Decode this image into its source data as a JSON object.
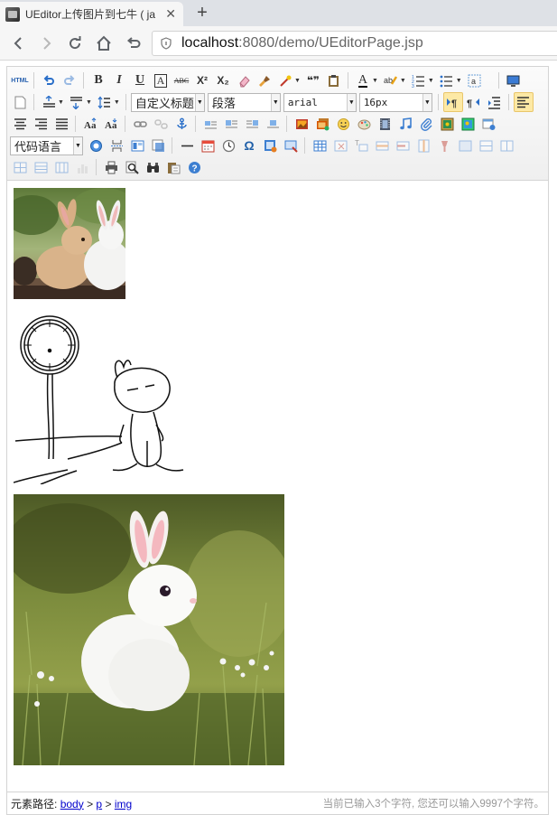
{
  "browser": {
    "tab_title": "UEditor上传图片到七牛 ( ja",
    "tab_close": "✕",
    "new_tab": "+",
    "address_host": "localhost",
    "address_rest": ":8080/demo/UEditorPage.jsp"
  },
  "toolbar": {
    "html_label": "HTML",
    "custom_title": "自定义标题",
    "paragraph": "段落",
    "font_family": "arial",
    "font_size": "16px",
    "code_language": "代码语言",
    "bold": "B",
    "italic": "I",
    "underline": "U",
    "fontborder": "A",
    "strike": "ABC",
    "superscript": "X²",
    "subscript": "X₂",
    "quote": "❝❞",
    "forecolor": "A",
    "omega": "Ω"
  },
  "content": {
    "images": [
      "rabbits-photo",
      "cartoon-rabbit-clock-drawing",
      "white-rabbit-grass-photo"
    ]
  },
  "status": {
    "path_label": "元素路径:",
    "path": [
      "body",
      "p",
      "img"
    ],
    "separator": ">",
    "word_count": "当前已输入3个字符, 您还可以输入9997个字符。"
  }
}
